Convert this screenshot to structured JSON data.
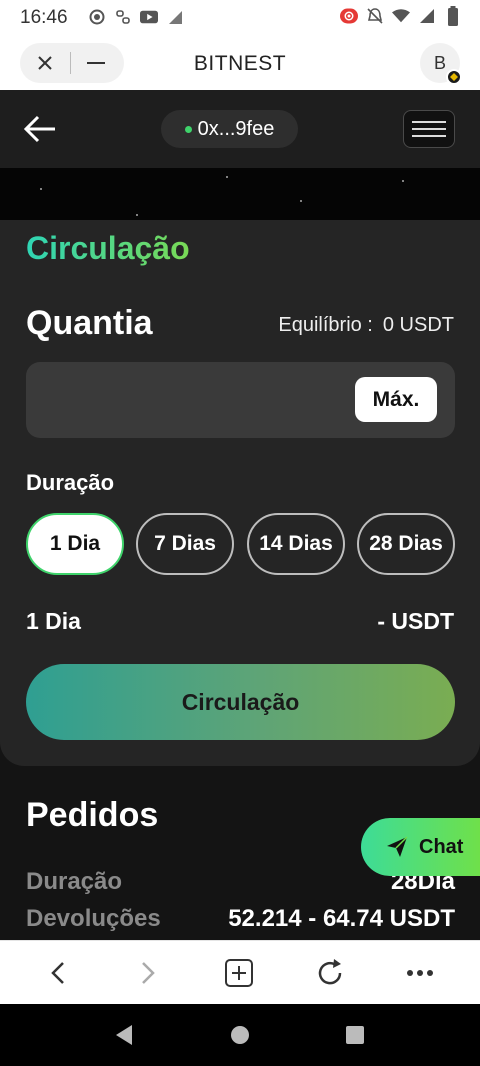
{
  "status_bar": {
    "time": "16:46",
    "icons_left": [
      "record-icon",
      "link-icon",
      "youtube-icon",
      "signal-icon"
    ],
    "icons_right": [
      "screen-record-icon",
      "mute-icon",
      "wifi-icon",
      "signal-icon",
      "battery-icon"
    ]
  },
  "browser": {
    "title": "BITNEST",
    "avatar_letter": "B",
    "bottom_icons": [
      "back-icon",
      "forward-icon",
      "new-tab-icon",
      "reload-icon",
      "more-icon"
    ]
  },
  "header": {
    "wallet": "0x...9fee",
    "status_color": "#3fd36b"
  },
  "card": {
    "title": "Circulação",
    "amount_label": "Quantia",
    "balance_label": "Equilíbrio :",
    "balance_value": "0 USDT",
    "amount_value": "",
    "max_label": "Máx.",
    "duration_label": "Duração",
    "durations": [
      {
        "label": "1 Dia",
        "selected": true
      },
      {
        "label": "7 Dias",
        "selected": false
      },
      {
        "label": "14 Dias",
        "selected": false
      },
      {
        "label": "28 Dias",
        "selected": false
      }
    ],
    "summary_duration": "1 Dia",
    "summary_returns": "- USDT",
    "submit_label": "Circulação"
  },
  "orders": {
    "title": "Pedidos",
    "rows": [
      {
        "label": "Duração",
        "value": "28Dia"
      },
      {
        "label": "Devoluções",
        "value": "52.214 - 64.74 USDT"
      }
    ]
  },
  "chat": {
    "label": "Chat"
  },
  "colors": {
    "accent_gradient_start": "#2fd5b5",
    "accent_gradient_end": "#79d955",
    "card_bg": "#252525"
  }
}
